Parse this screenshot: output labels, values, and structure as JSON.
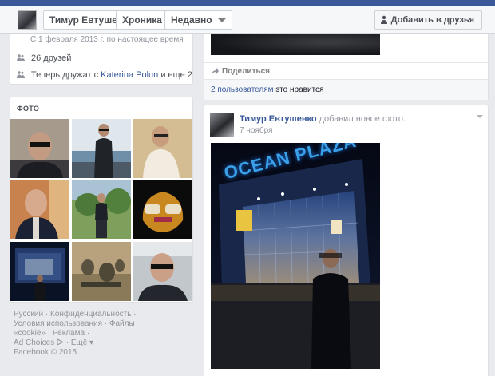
{
  "header": {
    "name": "Тимур Евтушенко",
    "chronicle_label": "Хроника",
    "recent_label": "Недавно",
    "add_friend_label": "Добавить в друзья"
  },
  "about": {
    "since_text": "С 1 февраля 2013 г. по настоящее время",
    "friends_text": "26 друзей",
    "friends_now_prefix": "Теперь дружат с ",
    "friends_now_link": "Katerina Polun",
    "friends_now_suffix": " и еще 2"
  },
  "photos": {
    "title": "ФОТО",
    "count": 9
  },
  "footer": {
    "links": [
      "Русский",
      "Конфиденциальность",
      "Условия использования",
      "Файлы «cookie»",
      "Реклама",
      "Ad Choices",
      "Ещё"
    ],
    "copyright": "Facebook © 2015"
  },
  "prev_post": {
    "share_label": "Поделиться",
    "likes_link": "2 пользователям",
    "likes_suffix": " это нравится"
  },
  "post": {
    "author": "Тимур Евтушенко",
    "action": " добавил новое фото.",
    "time": "7 ноября",
    "sign_text": "OCEAN PLAZA"
  },
  "colors": {
    "brand": "#3b5998",
    "link": "#365899",
    "muted": "#90949c",
    "sign_blue": "#3aa0e8"
  },
  "icons": {
    "friends": "friends-icon",
    "friends_now": "friends-now-icon",
    "share": "share-icon",
    "add_friend": "add-person-icon",
    "ad_choices": "ad-choices-icon"
  }
}
